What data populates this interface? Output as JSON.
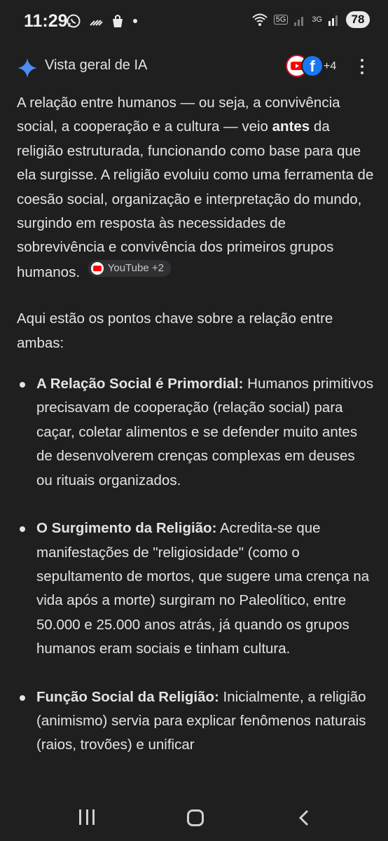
{
  "status": {
    "time": "11:29",
    "network_5g": "5G",
    "network_3g": "3G",
    "battery": "78",
    "icons": [
      "whatsapp-icon",
      "signal-slash-icon",
      "shopping-bag-icon",
      "dot-icon",
      "wifi-icon",
      "cell-signal-icon"
    ]
  },
  "header": {
    "title": "Vista geral de IA",
    "source_count": "+4",
    "sparkle_color": "#4c8df6"
  },
  "body": {
    "p1_part1": "A relação entre humanos — ou seja, a convivência social, a cooperação e a cultura — veio ",
    "p1_bold": "antes",
    "p1_part2": " da religião estruturada, funcionando como base para que ela surgisse. A religião evoluiu como uma ferramenta de coesão social, organização e interpretação do mundo, surgindo em resposta às necessidades de sobrevivência e convivência dos primeiros grupos humanos.",
    "chip_label": "YouTube +2",
    "p2": "Aqui estão os pontos chave sobre a relação entre ambas:",
    "points": [
      {
        "title": "A Relação Social é Primordial:",
        "text": " Humanos primitivos precisavam de cooperação (relação social) para caçar, coletar alimentos e se defender muito antes de desenvolverem crenças complexas em deuses ou rituais organizados."
      },
      {
        "title": "O Surgimento da Religião:",
        "text": " Acredita-se que manifestações de \"religiosidade\" (como o sepultamento de mortos, que sugere uma crença na vida após a morte) surgiram no Paleolítico, entre 50.000 e 25.000 anos atrás, já quando os grupos humanos eram sociais e tinham cultura."
      },
      {
        "title": "Função Social da Religião:",
        "text": " Inicialmente, a religião (animismo) servia para explicar fenômenos naturais (raios, trovões) e unificar"
      }
    ]
  },
  "nav": {
    "icons": [
      "recents-icon",
      "home-icon",
      "back-icon"
    ]
  }
}
